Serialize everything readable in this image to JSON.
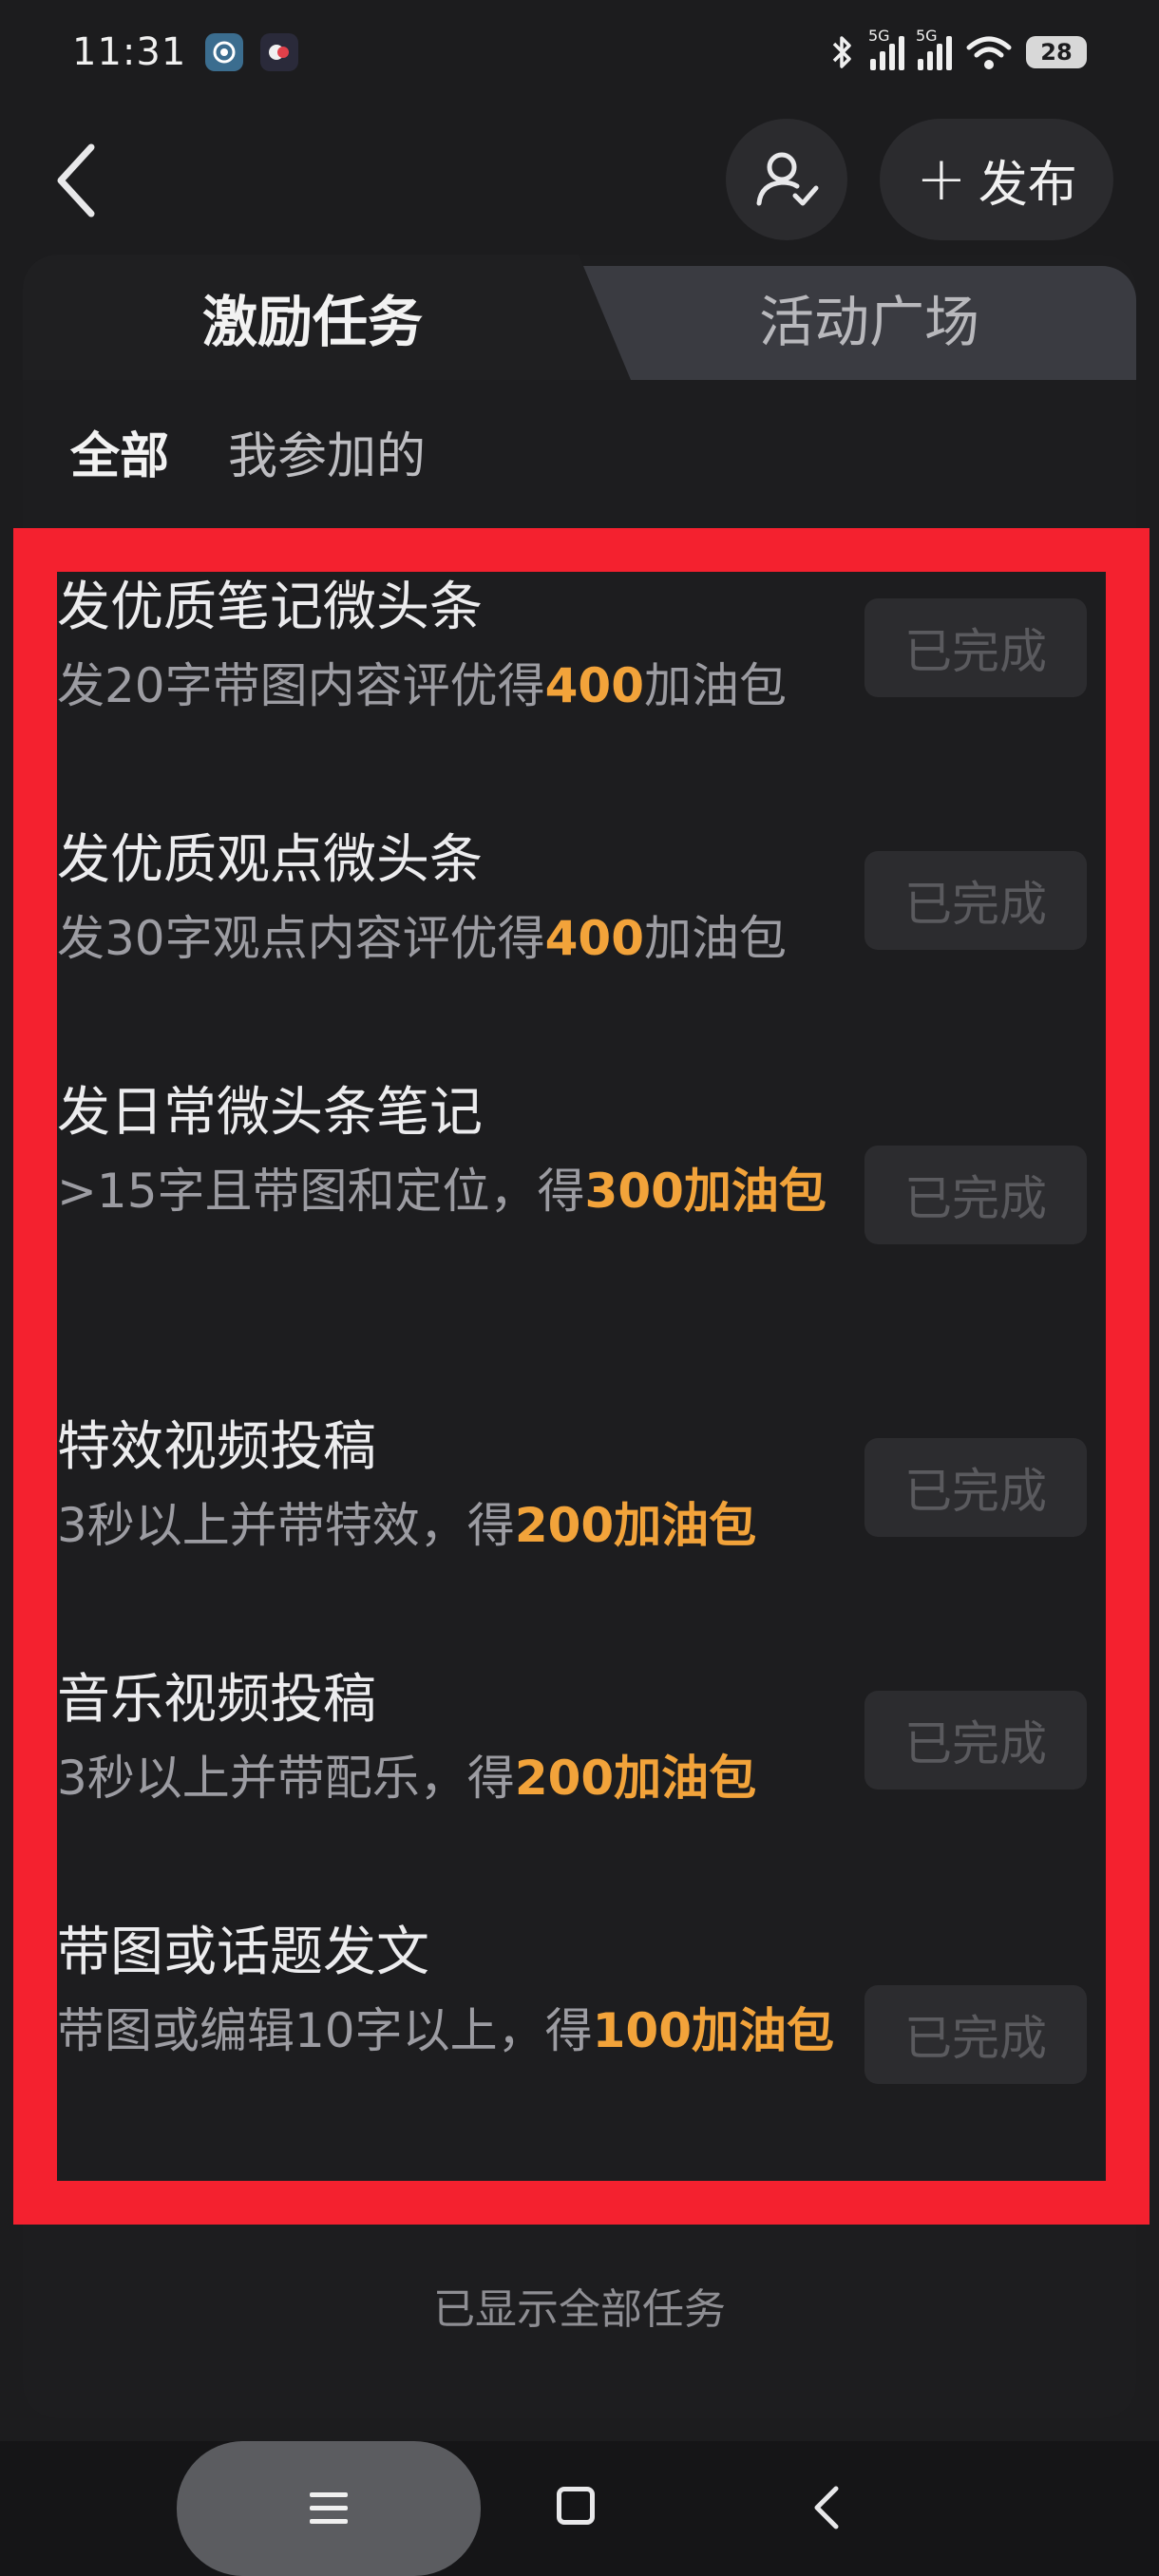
{
  "status_bar": {
    "time": "11:31",
    "signal1": "5G",
    "signal2": "5G",
    "battery": "28"
  },
  "header": {
    "publish_label": "发布"
  },
  "tabs": [
    {
      "label": "激励任务",
      "active": true
    },
    {
      "label": "活动广场",
      "active": false
    }
  ],
  "filters": [
    {
      "label": "全部",
      "active": true
    },
    {
      "label": "我参加的",
      "active": false
    }
  ],
  "tasks": [
    {
      "title": "发优质笔记微头条",
      "desc_prefix": "发20字带图内容评优得",
      "desc_highlight": "400",
      "desc_suffix": "加油包",
      "status": "已完成"
    },
    {
      "title": "发优质观点微头条",
      "desc_prefix": "发30字观点内容评优得",
      "desc_highlight": "400",
      "desc_suffix": "加油包",
      "status": "已完成"
    },
    {
      "title": "发日常微头条笔记",
      "desc_prefix": ">15字且带图和定位，得",
      "desc_highlight": "300加油包",
      "desc_suffix": "",
      "status": "已完成"
    },
    {
      "title": "特效视频投稿",
      "desc_prefix": "3秒以上并带特效，得",
      "desc_highlight": "200加油包",
      "desc_suffix": "",
      "status": "已完成"
    },
    {
      "title": "音乐视频投稿",
      "desc_prefix": "3秒以上并带配乐，得",
      "desc_highlight": "200加油包",
      "desc_suffix": "",
      "status": "已完成"
    },
    {
      "title": "带图或话题发文",
      "desc_prefix": "带图或编辑10字以上，得",
      "desc_highlight": "100加油包",
      "desc_suffix": "",
      "status": "已完成"
    }
  ],
  "footer_note": "已显示全部任务",
  "colors": {
    "background": "#1c1c1e",
    "highlight_border": "#f4212f",
    "reward_accent": "#f2a33a"
  }
}
